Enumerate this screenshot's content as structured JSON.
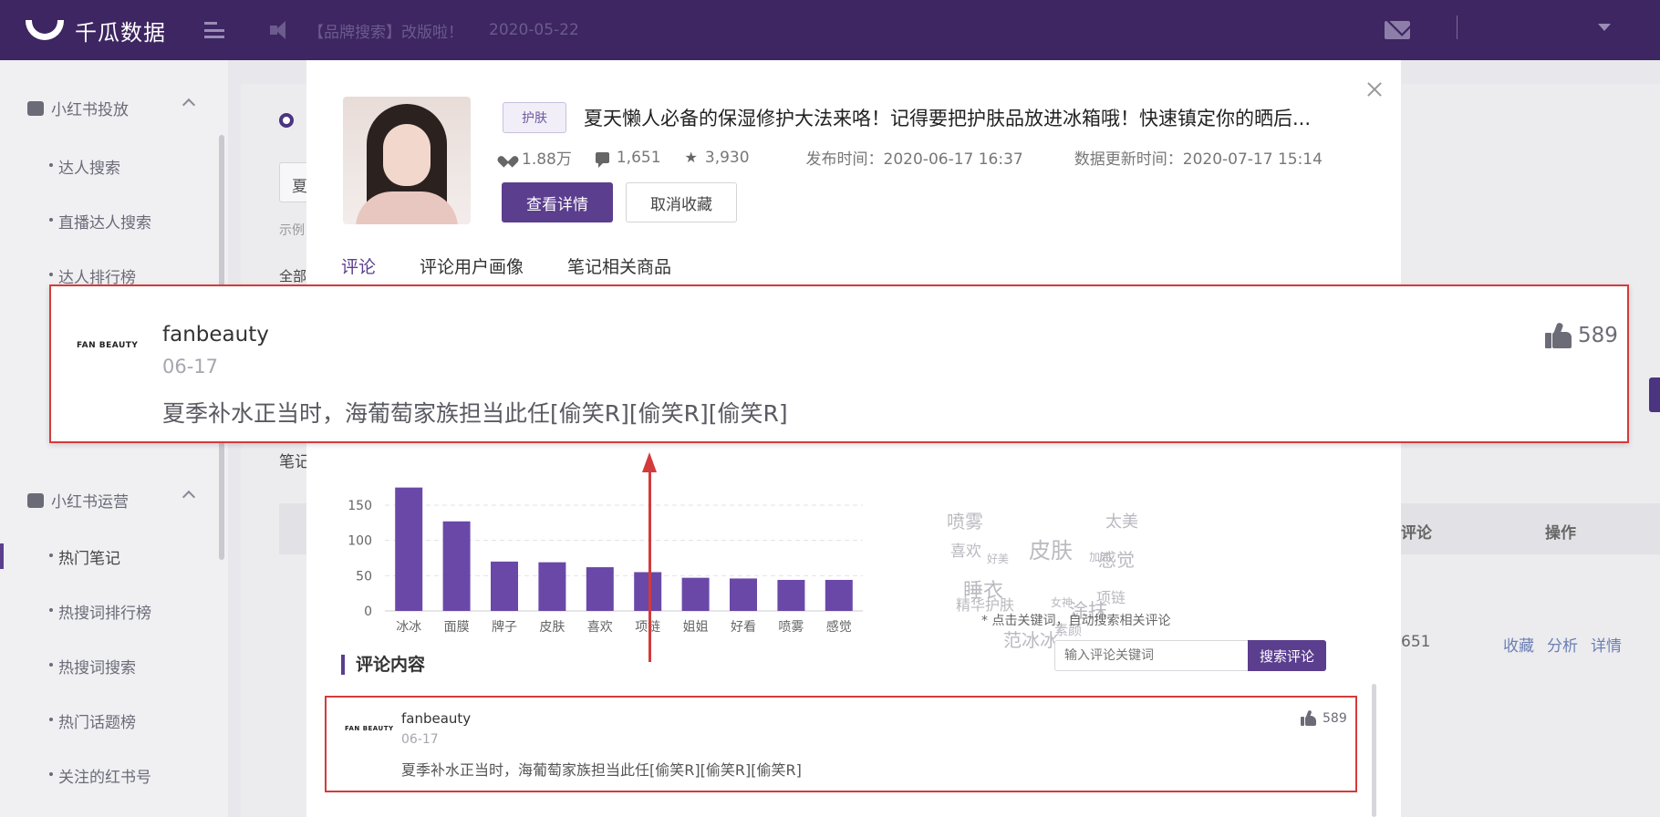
{
  "app": {
    "logo_text": "千瓜数据",
    "notice": "【品牌搜索】改版啦！",
    "notice_date": "2020-05-22"
  },
  "sidebar": {
    "group1": "小红书投放",
    "group2": "小红书运营",
    "items": [
      "达人搜索",
      "直播达人搜索",
      "达人排行榜",
      "热门笔记",
      "热搜词排行榜",
      "热搜词搜索",
      "热门话题榜",
      "关注的红书号"
    ]
  },
  "background": {
    "input_char": "夏",
    "example_hint": "示例",
    "filter_all": "全部",
    "notes_label": "笔记",
    "column_comments": "评论",
    "column_actions": "操作",
    "row_count": "651",
    "actions": [
      "收藏",
      "分析",
      "详情"
    ]
  },
  "note": {
    "tag": "护肤",
    "title": "夏天懒人必备的保湿修护大法来咯！记得要把护肤品放进冰箱哦！快速镇定你的晒后...",
    "likes": "1.88万",
    "comments": "1,651",
    "collects": "3,930",
    "publish_time": "发布时间：2020-06-17 16:37",
    "update_time": "数据更新时间：2020-07-17 15:14",
    "view_detail": "查看详情",
    "uncollect": "取消收藏"
  },
  "tabs": [
    "评论",
    "评论用户画像",
    "笔记相关商品"
  ],
  "chart_data": {
    "type": "bar",
    "categories": [
      "冰冰",
      "面膜",
      "牌子",
      "皮肤",
      "喜欢",
      "项链",
      "姐姐",
      "好看",
      "喷雾",
      "感觉"
    ],
    "values": [
      175,
      127,
      70,
      69,
      62,
      55,
      47,
      46,
      44,
      44
    ],
    "yticks": [
      "0",
      "50",
      "100",
      "150"
    ],
    "ylim": [
      0,
      175
    ],
    "color": "#6a48a8",
    "grid": true
  },
  "wordcloud": {
    "words": [
      "喷雾",
      "太美",
      "皮肤",
      "喜欢",
      "感觉",
      "睡衣",
      "精华护肤",
      "涂抹",
      "项链",
      "范冰冰",
      "素颜",
      "好美",
      "加油",
      "女神"
    ],
    "hint": "* 点击关键词，自动搜索相关评论"
  },
  "comments_section": {
    "title": "评论内容",
    "search_placeholder": "输入评论关键词",
    "search_button": "搜索评论"
  },
  "comment": {
    "brand": "FAN BEAUTY",
    "user": "fanbeauty",
    "date": "06-17",
    "text": "夏季补水正当时，海葡萄家族担当此任[偷笑R][偷笑R][偷笑R]",
    "likes": "589"
  },
  "colors": {
    "topbar": "#3d2661",
    "primary": "#5b3e8e",
    "highlight": "#d33b3b"
  }
}
